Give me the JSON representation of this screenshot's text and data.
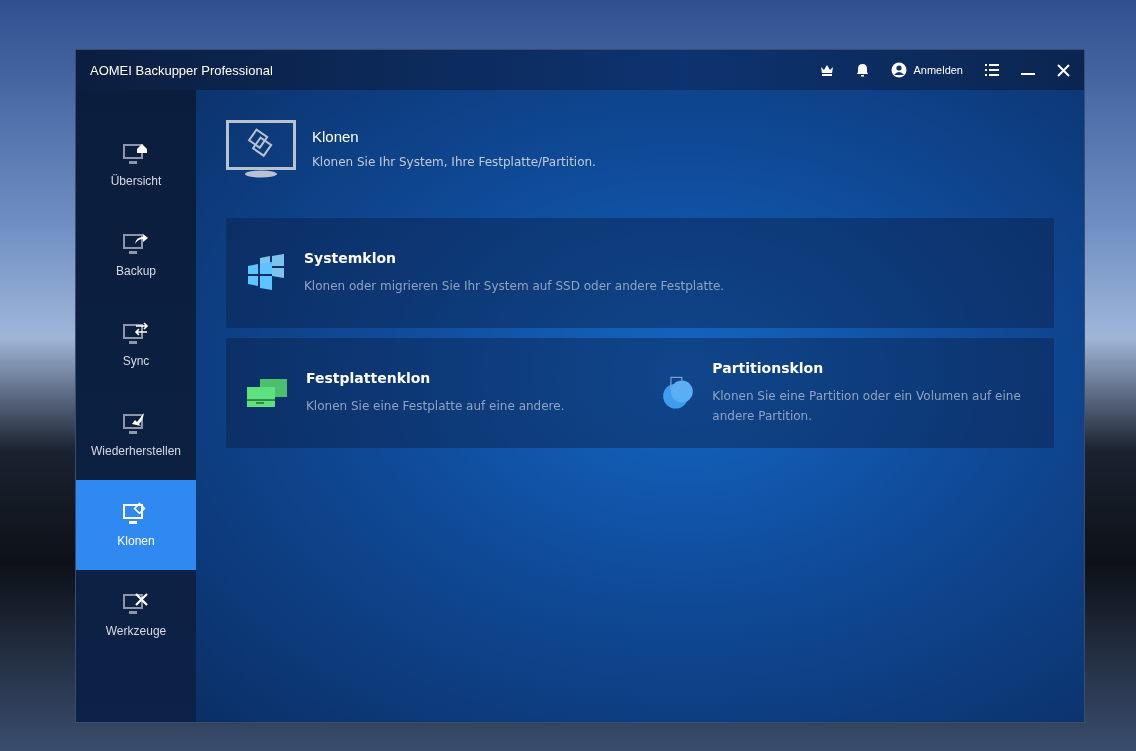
{
  "window": {
    "title": "AOMEI Backupper Professional",
    "login": "Anmelden"
  },
  "sidebar": {
    "items": [
      {
        "label": "Übersicht",
        "kind": "home",
        "selected": false
      },
      {
        "label": "Backup",
        "kind": "share",
        "selected": false
      },
      {
        "label": "Sync",
        "kind": "sync",
        "selected": false
      },
      {
        "label": "Wiederherstellen",
        "kind": "restore",
        "selected": false
      },
      {
        "label": "Klonen",
        "kind": "clone",
        "selected": true
      },
      {
        "label": "Werkzeuge",
        "kind": "tools",
        "selected": false
      }
    ]
  },
  "header": {
    "title": "Klonen",
    "subtitle": "Klonen Sie Ihr System, Ihre Festplatte/Partition."
  },
  "cards": [
    {
      "title": "Systemklon",
      "description": "Klonen oder migrieren Sie Ihr System auf SSD oder andere Festplatte.",
      "kind": "windows"
    },
    {
      "title": "Festplattenklon",
      "description": "Klonen Sie eine Festplatte auf eine andere.",
      "kind": "disk"
    },
    {
      "title": "Partitionsklon",
      "description": "Klonen Sie eine Partition oder ein Volumen auf eine andere Partition.",
      "kind": "partition"
    }
  ]
}
